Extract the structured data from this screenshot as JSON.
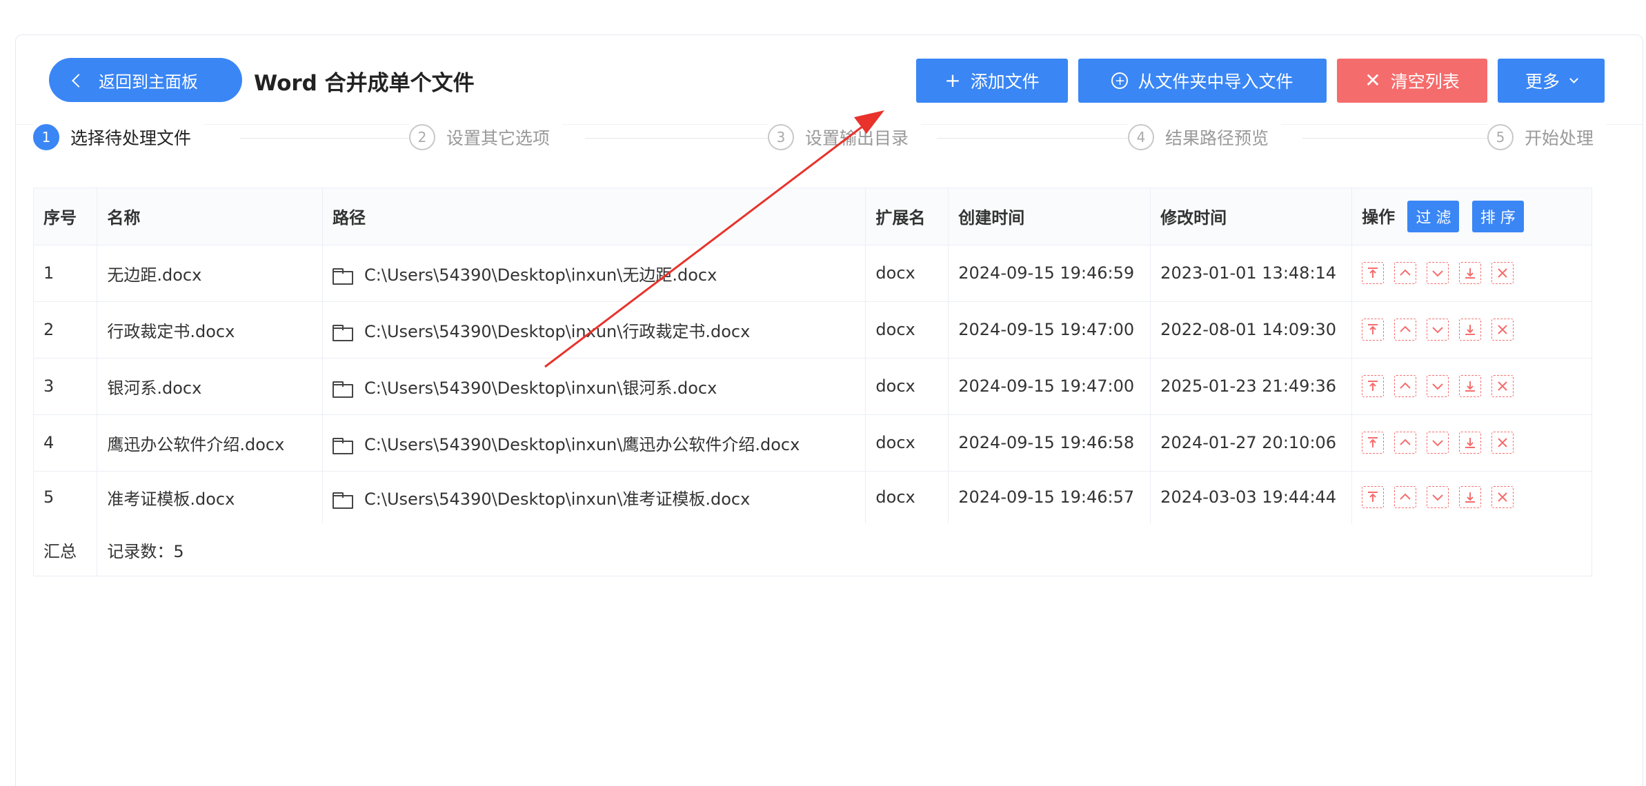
{
  "header": {
    "back_label": "返回到主面板",
    "title": "Word 合并成单个文件",
    "add_label": "添加文件",
    "import_label": "从文件夹中导入文件",
    "clear_label": "清空列表",
    "more_label": "更多"
  },
  "steps": [
    {
      "num": "1",
      "label": "选择待处理文件"
    },
    {
      "num": "2",
      "label": "设置其它选项"
    },
    {
      "num": "3",
      "label": "设置输出目录"
    },
    {
      "num": "4",
      "label": "结果路径预览"
    },
    {
      "num": "5",
      "label": "开始处理"
    }
  ],
  "table": {
    "headers": {
      "index": "序号",
      "name": "名称",
      "path": "路径",
      "ext": "扩展名",
      "created": "创建时间",
      "modified": "修改时间",
      "ops": "操作",
      "filter": "过 滤",
      "sort": "排 序"
    },
    "rows": [
      {
        "index": "1",
        "name": "无边距.docx",
        "path": "C:\\Users\\54390\\Desktop\\inxun\\无边距.docx",
        "ext": "docx",
        "created": "2024-09-15 19:46:59",
        "modified": "2023-01-01 13:48:14"
      },
      {
        "index": "2",
        "name": "行政裁定书.docx",
        "path": "C:\\Users\\54390\\Desktop\\inxun\\行政裁定书.docx",
        "ext": "docx",
        "created": "2024-09-15 19:47:00",
        "modified": "2022-08-01 14:09:30"
      },
      {
        "index": "3",
        "name": "银河系.docx",
        "path": "C:\\Users\\54390\\Desktop\\inxun\\银河系.docx",
        "ext": "docx",
        "created": "2024-09-15 19:47:00",
        "modified": "2025-01-23 21:49:36"
      },
      {
        "index": "4",
        "name": "鹰迅办公软件介绍.docx",
        "path": "C:\\Users\\54390\\Desktop\\inxun\\鹰迅办公软件介绍.docx",
        "ext": "docx",
        "created": "2024-09-15 19:46:58",
        "modified": "2024-01-27 20:10:06"
      },
      {
        "index": "5",
        "name": "准考证模板.docx",
        "path": "C:\\Users\\54390\\Desktop\\inxun\\准考证模板.docx",
        "ext": "docx",
        "created": "2024-09-15 19:46:57",
        "modified": "2024-03-03 19:44:44"
      }
    ],
    "summary": {
      "label": "汇总",
      "count": "记录数：5"
    }
  },
  "colors": {
    "primary": "#3a86f5",
    "danger": "#f56c6c",
    "annotation_arrow": "#e8322b"
  },
  "icons": {
    "back": "chevron-left-icon",
    "add": "plus-icon",
    "import": "circle-plus-icon",
    "clear": "close-icon",
    "more": "chevron-down-icon",
    "folder": "folder-icon"
  }
}
